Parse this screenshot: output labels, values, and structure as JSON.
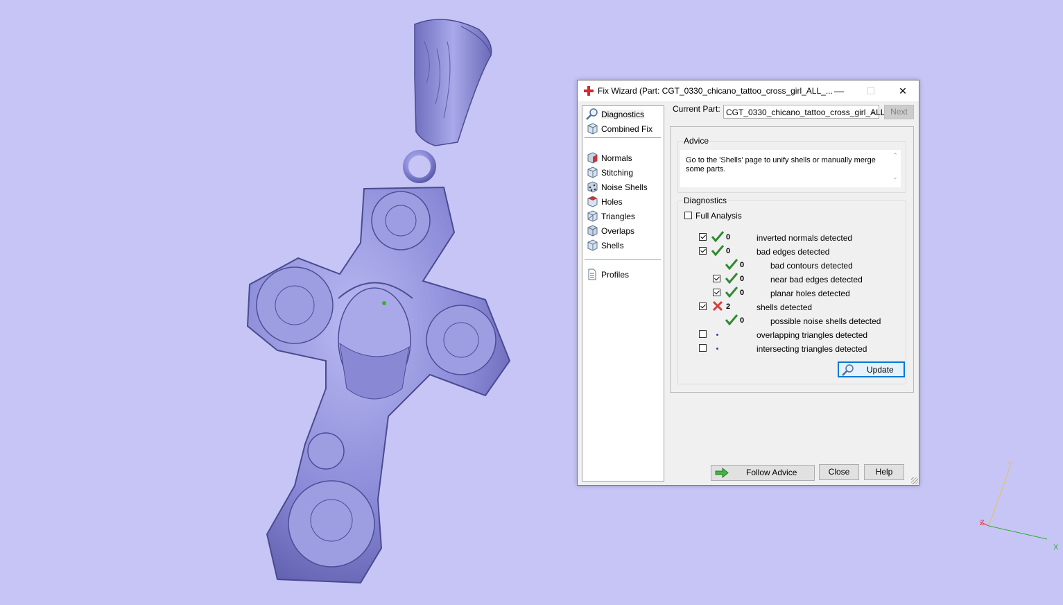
{
  "dialog": {
    "title": "Fix Wizard (Part: CGT_0330_chicano_tattoo_cross_girl_ALL_...",
    "minimize": "—",
    "maximize": "☐",
    "close": "✕"
  },
  "nav": {
    "top": [
      {
        "label": "Diagnostics",
        "icon": "magnifier-icon",
        "selected": true
      },
      {
        "label": "Combined Fix",
        "icon": "cube-icon"
      }
    ],
    "fixes": [
      {
        "label": "Normals",
        "icon": "normals-cube-icon"
      },
      {
        "label": "Stitching",
        "icon": "stitching-cube-icon"
      },
      {
        "label": "Noise Shells",
        "icon": "noise-shells-icon"
      },
      {
        "label": "Holes",
        "icon": "holes-cube-icon"
      },
      {
        "label": "Triangles",
        "icon": "triangles-cube-icon"
      },
      {
        "label": "Overlaps",
        "icon": "overlaps-cube-icon"
      },
      {
        "label": "Shells",
        "icon": "shells-cube-icon"
      }
    ],
    "bottom": [
      {
        "label": "Profiles",
        "icon": "document-icon"
      }
    ]
  },
  "current_part": {
    "label": "Current Part:",
    "value": "CGT_0330_chicano_tattoo_cross_girl_ALL"
  },
  "next_label": "Next",
  "advice": {
    "title": "Advice",
    "text": "Go to the 'Shells' page to unify shells or manually merge some parts."
  },
  "diagnostics": {
    "title": "Diagnostics",
    "full_analysis_label": "Full Analysis",
    "full_analysis_checked": false,
    "rows": [
      {
        "checkbox": true,
        "checked": true,
        "status": "ok",
        "count": "0",
        "label": "inverted normals detected",
        "indent": 0
      },
      {
        "checkbox": true,
        "checked": true,
        "status": "ok",
        "count": "0",
        "label": "bad edges detected",
        "indent": 0
      },
      {
        "checkbox": false,
        "checked": false,
        "status": "ok",
        "count": "0",
        "label": "bad contours detected",
        "indent": 1
      },
      {
        "checkbox": true,
        "checked": true,
        "status": "ok",
        "count": "0",
        "label": "near bad edges detected",
        "indent": 1
      },
      {
        "checkbox": true,
        "checked": true,
        "status": "ok",
        "count": "0",
        "label": "planar holes detected",
        "indent": 1
      },
      {
        "checkbox": true,
        "checked": true,
        "status": "error",
        "count": "2",
        "label": "shells detected",
        "indent": 0
      },
      {
        "checkbox": false,
        "checked": false,
        "status": "ok",
        "count": "0",
        "label": "possible noise shells detected",
        "indent": 1
      },
      {
        "checkbox": true,
        "checked": false,
        "status": "pending",
        "count": "",
        "label": "overlapping triangles detected",
        "indent": 0
      },
      {
        "checkbox": true,
        "checked": false,
        "status": "pending",
        "count": "",
        "label": "intersecting triangles detected",
        "indent": 0
      }
    ],
    "update_label": "Update"
  },
  "footer": {
    "follow_advice": "Follow Advice",
    "close": "Close",
    "help": "Help"
  },
  "axes": {
    "x": "X",
    "y": "Y",
    "z": "Z"
  },
  "colors": {
    "viewport_bg": "#c7c5f5",
    "model": "#8f8fdc",
    "ok": "#2f8a2f",
    "error": "#d83b3b",
    "accent": "#0078d7"
  }
}
